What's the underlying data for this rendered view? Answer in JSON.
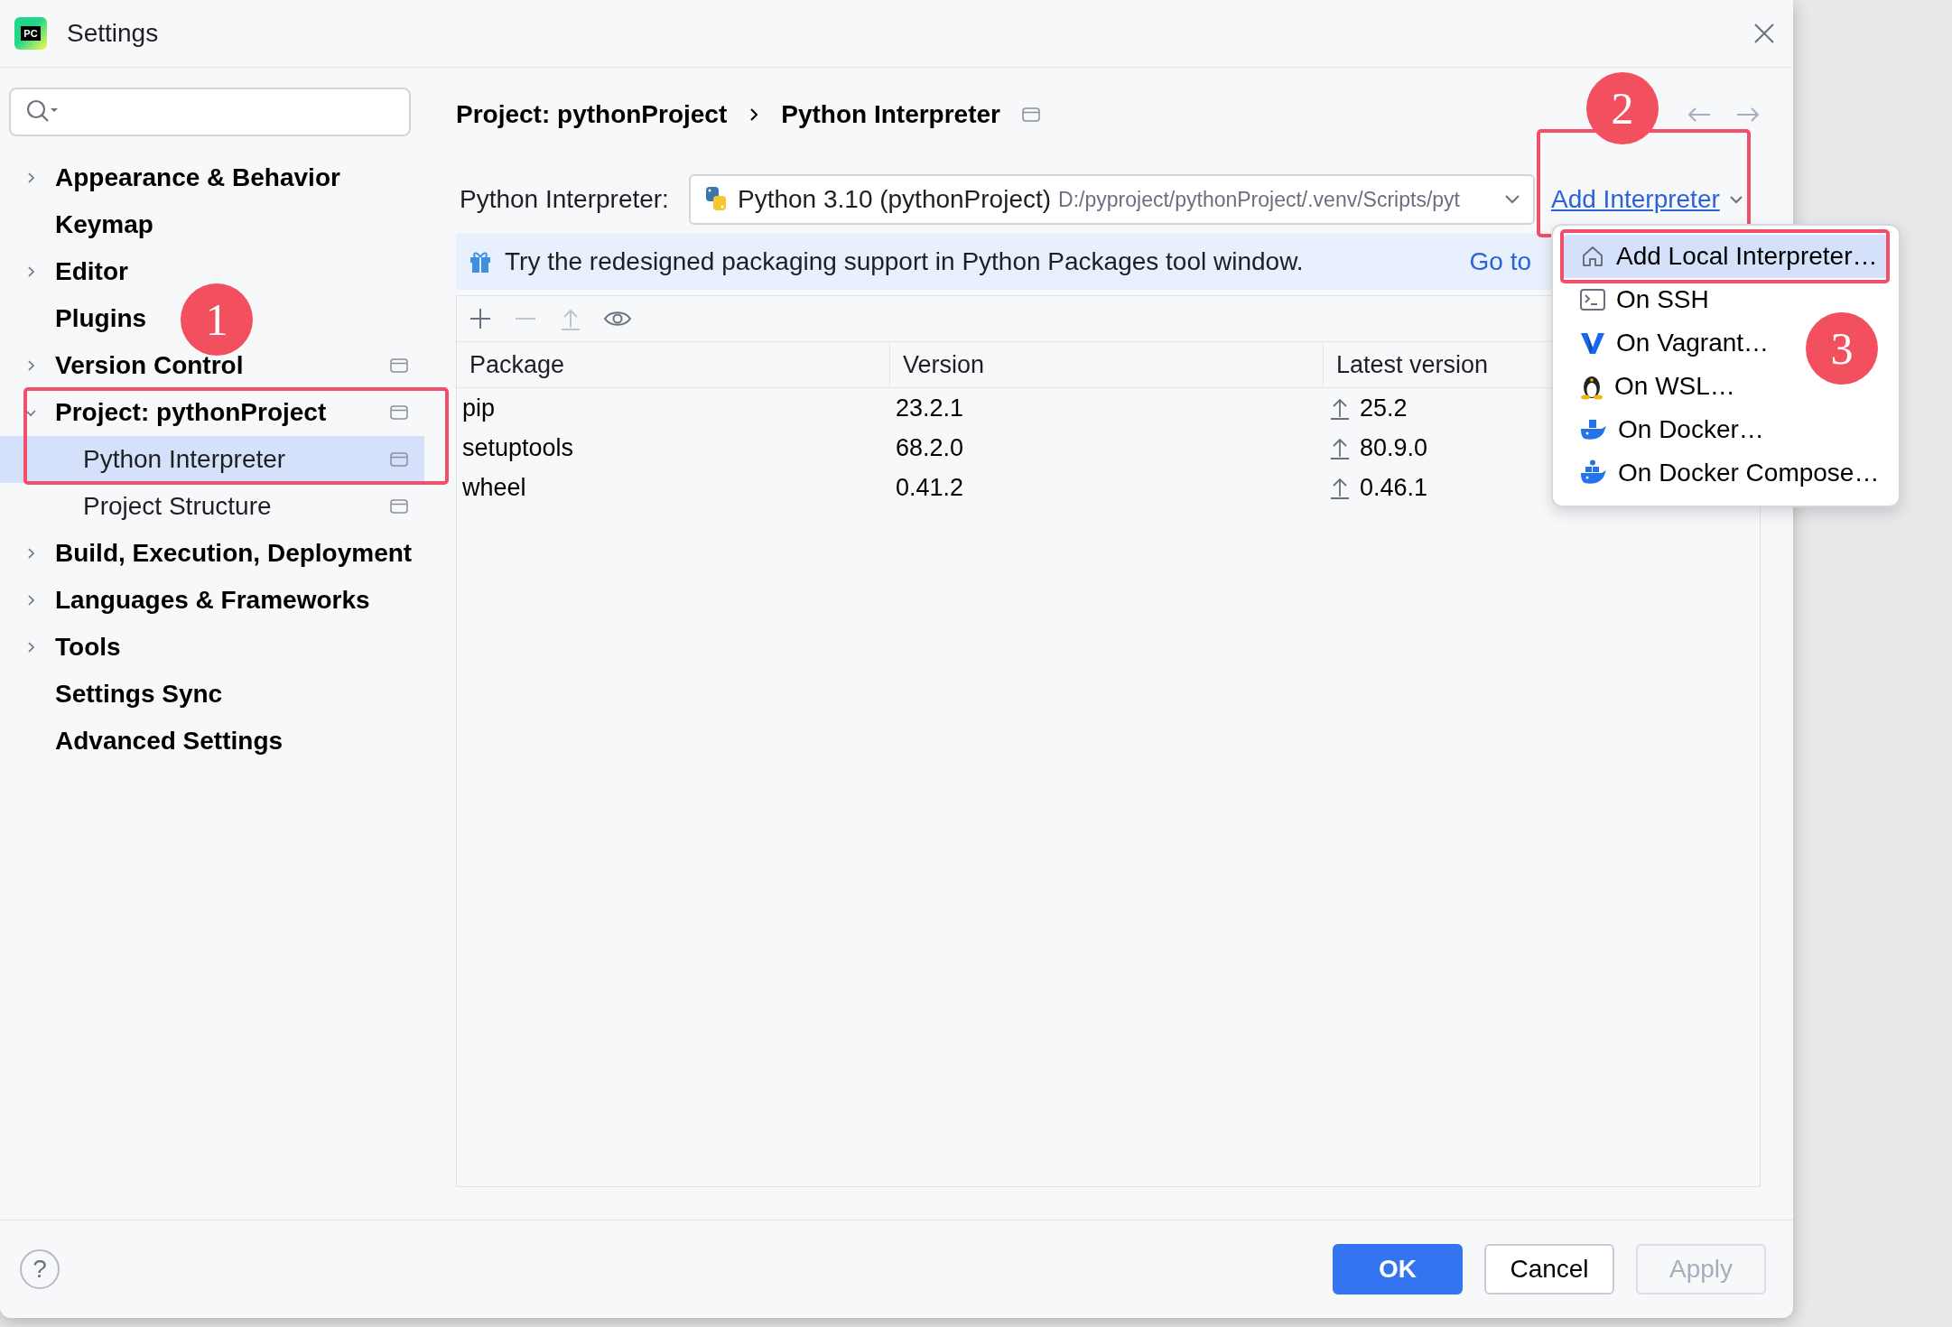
{
  "window": {
    "title": "Settings",
    "logo_text": "PC"
  },
  "sidebar": {
    "items": [
      {
        "label": "Appearance & Behavior",
        "expanded": false,
        "scoped": false,
        "selected": false,
        "highlighted": false
      },
      {
        "label": "Keymap",
        "scoped": false,
        "selected": false,
        "highlighted": false
      },
      {
        "label": "Editor",
        "expanded": false,
        "scoped": false,
        "selected": false,
        "highlighted": false
      },
      {
        "label": "Plugins",
        "scoped": false,
        "selected": false,
        "highlighted": false
      },
      {
        "label": "Version Control",
        "expanded": false,
        "scoped": true,
        "selected": false,
        "highlighted": false
      },
      {
        "label": "Project: pythonProject",
        "expanded": true,
        "scoped": true,
        "selected": false,
        "highlighted": true,
        "children": [
          {
            "label": "Python Interpreter",
            "scoped": true,
            "selected": true,
            "highlighted": true
          },
          {
            "label": "Project Structure",
            "scoped": true,
            "selected": false,
            "highlighted": false
          }
        ]
      },
      {
        "label": "Build, Execution, Deployment",
        "expanded": false,
        "scoped": false,
        "selected": false,
        "highlighted": false
      },
      {
        "label": "Languages & Frameworks",
        "expanded": false,
        "scoped": false,
        "selected": false,
        "highlighted": false
      },
      {
        "label": "Tools",
        "expanded": false,
        "scoped": false,
        "selected": false,
        "highlighted": false
      },
      {
        "label": "Settings Sync",
        "scoped": false,
        "selected": false,
        "highlighted": false
      },
      {
        "label": "Advanced Settings",
        "scoped": false,
        "selected": false,
        "highlighted": false
      }
    ]
  },
  "breadcrumb": [
    "Project: pythonProject",
    "Python Interpreter"
  ],
  "interpreter": {
    "label": "Python Interpreter:",
    "name": "Python 3.10 (pythonProject)",
    "path": "D:/pyproject/pythonProject/.venv/Scripts/pyt",
    "add_link": "Add Interpreter",
    "add_link_highlighted": true
  },
  "banner": {
    "message": "Try the redesigned packaging support in Python Packages tool window.",
    "link": "Go to"
  },
  "toolbar": [
    {
      "kind": "add",
      "disabled": false
    },
    {
      "kind": "remove",
      "disabled": true
    },
    {
      "kind": "upgrade",
      "disabled": true
    },
    {
      "kind": "show",
      "disabled": false
    }
  ],
  "table": {
    "columns": [
      "Package",
      "Version",
      "Latest version"
    ],
    "rows": [
      {
        "package": "pip",
        "version": "23.2.1",
        "latest": "25.2",
        "upgradable": true
      },
      {
        "package": "setuptools",
        "version": "68.2.0",
        "latest": "80.9.0",
        "upgradable": true
      },
      {
        "package": "wheel",
        "version": "0.41.2",
        "latest": "0.46.1",
        "upgradable": true
      }
    ]
  },
  "menu": {
    "items": [
      {
        "kind": "local",
        "label": "Add Local Interpreter…",
        "selected": true,
        "highlighted": true
      },
      {
        "kind": "ssh",
        "label": "On SSH",
        "selected": false,
        "highlighted": false
      },
      {
        "kind": "vagrant",
        "label": "On Vagrant…",
        "selected": false,
        "highlighted": false
      },
      {
        "kind": "wsl",
        "label": "On WSL…",
        "selected": false,
        "highlighted": false
      },
      {
        "kind": "docker",
        "label": "On Docker…",
        "selected": false,
        "highlighted": false
      },
      {
        "kind": "compose",
        "label": "On Docker Compose…",
        "selected": false,
        "highlighted": false
      }
    ]
  },
  "callouts": [
    {
      "label": "1"
    },
    {
      "label": "2"
    },
    {
      "label": "3"
    }
  ],
  "help": "?",
  "buttons": [
    {
      "label": "OK",
      "kind": "primary",
      "disabled": false
    },
    {
      "label": "Cancel",
      "kind": "secondary",
      "disabled": false
    },
    {
      "label": "Apply",
      "kind": "secondary",
      "disabled": true
    }
  ]
}
